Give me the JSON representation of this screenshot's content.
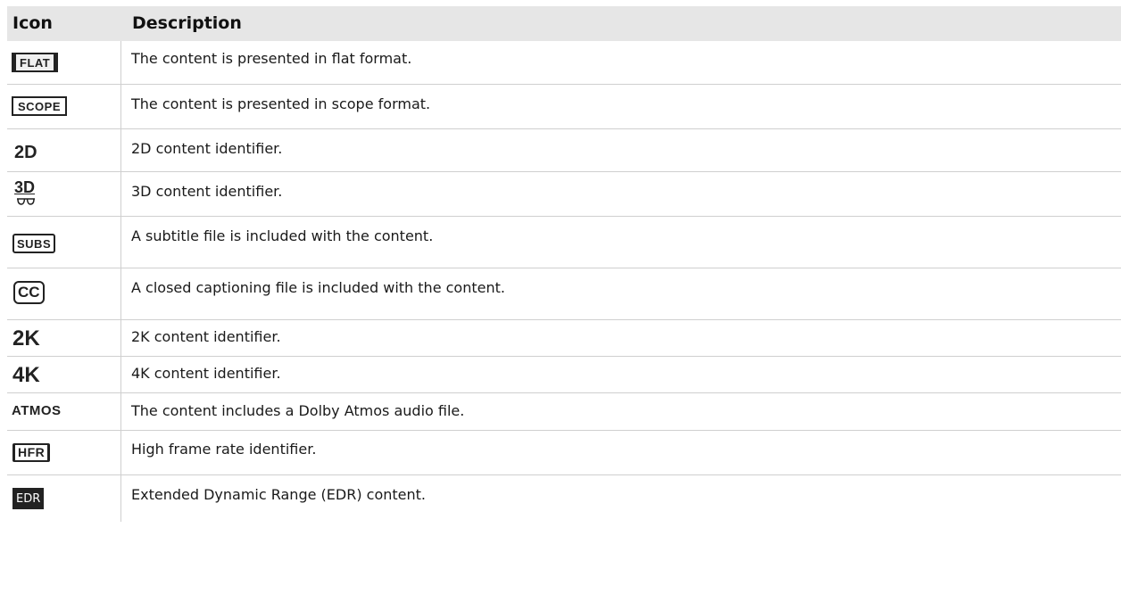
{
  "table": {
    "headers": {
      "icon": "Icon",
      "description": "Description"
    },
    "rows": [
      {
        "icon_name": "flat-format-icon",
        "icon_text": "FLAT",
        "description": "The content is presented in flat format."
      },
      {
        "icon_name": "scope-format-icon",
        "icon_text": "SCOPE",
        "description": "The content is presented in scope format."
      },
      {
        "icon_name": "2d-content-icon",
        "icon_text": "2D",
        "description": "2D content identifier."
      },
      {
        "icon_name": "3d-content-icon",
        "icon_text": "3D",
        "description": "3D content identifier."
      },
      {
        "icon_name": "subtitles-icon",
        "icon_text": "SUBS",
        "description": "A subtitle file is included with the content."
      },
      {
        "icon_name": "closed-captioning-icon",
        "icon_text": "CC",
        "description": "A closed captioning file is included with the content."
      },
      {
        "icon_name": "2k-content-icon",
        "icon_text": "2K",
        "description": "2K content identifier."
      },
      {
        "icon_name": "4k-content-icon",
        "icon_text": "4K",
        "description": "4K content identifier."
      },
      {
        "icon_name": "atmos-audio-icon",
        "icon_text": "ATMOS",
        "description": "The content includes a Dolby Atmos audio file."
      },
      {
        "icon_name": "hfr-icon",
        "icon_text": "HFR",
        "description": "High frame rate identifier."
      },
      {
        "icon_name": "edr-icon",
        "icon_text": "EDR",
        "description": "Extended Dynamic Range (EDR) content."
      }
    ]
  }
}
